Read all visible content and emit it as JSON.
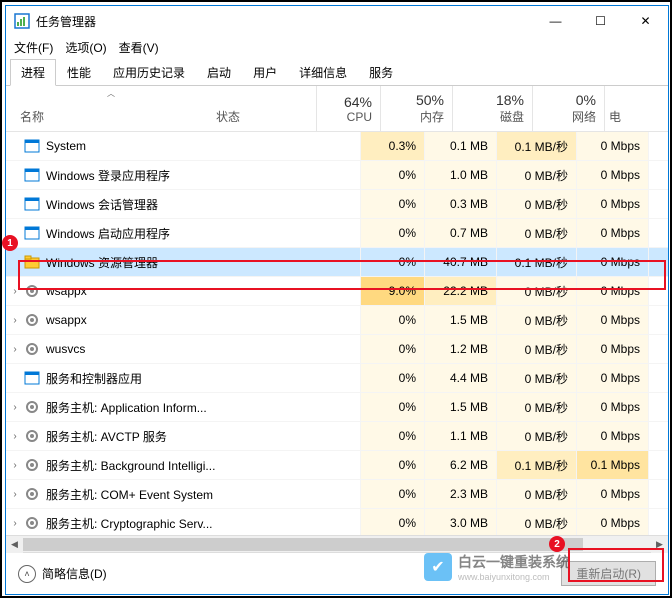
{
  "window": {
    "title": "任务管理器",
    "min": "—",
    "max": "☐",
    "close": "✕"
  },
  "menus": [
    "文件(F)",
    "选项(O)",
    "查看(V)"
  ],
  "tabs": [
    "进程",
    "性能",
    "应用历史记录",
    "启动",
    "用户",
    "详细信息",
    "服务"
  ],
  "headers": {
    "name": "名称",
    "status": "状态",
    "cpu": {
      "pct": "64%",
      "lbl": "CPU"
    },
    "mem": {
      "pct": "50%",
      "lbl": "内存"
    },
    "disk": {
      "pct": "18%",
      "lbl": "磁盘"
    },
    "net": {
      "pct": "0%",
      "lbl": "网络"
    },
    "end": "电"
  },
  "rows": [
    {
      "exp": false,
      "icon": "window",
      "name": "System",
      "cpu": "0.3%",
      "mem": "0.1 MB",
      "disk": "0.1 MB/秒",
      "net": "0 Mbps",
      "cpuL": 1,
      "memL": 0,
      "diskL": 1,
      "netL": 0
    },
    {
      "exp": false,
      "icon": "window",
      "name": "Windows 登录应用程序",
      "cpu": "0%",
      "mem": "1.0 MB",
      "disk": "0 MB/秒",
      "net": "0 Mbps",
      "cpuL": 0,
      "memL": 0,
      "diskL": 0,
      "netL": 0
    },
    {
      "exp": false,
      "icon": "window",
      "name": "Windows 会话管理器",
      "cpu": "0%",
      "mem": "0.3 MB",
      "disk": "0 MB/秒",
      "net": "0 Mbps",
      "cpuL": 0,
      "memL": 0,
      "diskL": 0,
      "netL": 0
    },
    {
      "exp": false,
      "icon": "window",
      "name": "Windows 启动应用程序",
      "cpu": "0%",
      "mem": "0.7 MB",
      "disk": "0 MB/秒",
      "net": "0 Mbps",
      "cpuL": 0,
      "memL": 0,
      "diskL": 0,
      "netL": 0
    },
    {
      "exp": false,
      "icon": "explorer",
      "name": "Windows 资源管理器",
      "cpu": "0%",
      "mem": "40.7 MB",
      "disk": "0.1 MB/秒",
      "net": "0 Mbps",
      "cpuL": 0,
      "memL": 1,
      "diskL": 1,
      "netL": 0,
      "selected": true
    },
    {
      "exp": true,
      "icon": "gear",
      "name": "wsappx",
      "cpu": "9.0%",
      "mem": "22.2 MB",
      "disk": "0 MB/秒",
      "net": "0 Mbps",
      "cpuL": 3,
      "memL": 1,
      "diskL": 0,
      "netL": 0
    },
    {
      "exp": true,
      "icon": "gear",
      "name": "wsappx",
      "cpu": "0%",
      "mem": "1.5 MB",
      "disk": "0 MB/秒",
      "net": "0 Mbps",
      "cpuL": 0,
      "memL": 0,
      "diskL": 0,
      "netL": 0
    },
    {
      "exp": true,
      "icon": "gear",
      "name": "wusvcs",
      "cpu": "0%",
      "mem": "1.2 MB",
      "disk": "0 MB/秒",
      "net": "0 Mbps",
      "cpuL": 0,
      "memL": 0,
      "diskL": 0,
      "netL": 0
    },
    {
      "exp": false,
      "icon": "window",
      "name": "服务和控制器应用",
      "cpu": "0%",
      "mem": "4.4 MB",
      "disk": "0 MB/秒",
      "net": "0 Mbps",
      "cpuL": 0,
      "memL": 0,
      "diskL": 0,
      "netL": 0
    },
    {
      "exp": true,
      "icon": "gear",
      "name": "服务主机: Application Inform...",
      "cpu": "0%",
      "mem": "1.5 MB",
      "disk": "0 MB/秒",
      "net": "0 Mbps",
      "cpuL": 0,
      "memL": 0,
      "diskL": 0,
      "netL": 0
    },
    {
      "exp": true,
      "icon": "gear",
      "name": "服务主机: AVCTP 服务",
      "cpu": "0%",
      "mem": "1.1 MB",
      "disk": "0 MB/秒",
      "net": "0 Mbps",
      "cpuL": 0,
      "memL": 0,
      "diskL": 0,
      "netL": 0
    },
    {
      "exp": true,
      "icon": "gear",
      "name": "服务主机: Background Intelligi...",
      "cpu": "0%",
      "mem": "6.2 MB",
      "disk": "0.1 MB/秒",
      "net": "0.1 Mbps",
      "cpuL": 0,
      "memL": 0,
      "diskL": 1,
      "netL": 2
    },
    {
      "exp": true,
      "icon": "gear",
      "name": "服务主机: COM+ Event System",
      "cpu": "0%",
      "mem": "2.3 MB",
      "disk": "0 MB/秒",
      "net": "0 Mbps",
      "cpuL": 0,
      "memL": 0,
      "diskL": 0,
      "netL": 0
    },
    {
      "exp": true,
      "icon": "gear",
      "name": "服务主机: Cryptographic Serv...",
      "cpu": "0%",
      "mem": "3.0 MB",
      "disk": "0 MB/秒",
      "net": "0 Mbps",
      "cpuL": 0,
      "memL": 0,
      "diskL": 0,
      "netL": 0
    }
  ],
  "footer": {
    "less": "简略信息(D)",
    "restart": "重新启动(R)"
  },
  "markers": {
    "m1": "1",
    "m2": "2"
  },
  "watermark": {
    "line1": "白云一键重装系统",
    "line2": "www.baiyunxitong.com"
  }
}
